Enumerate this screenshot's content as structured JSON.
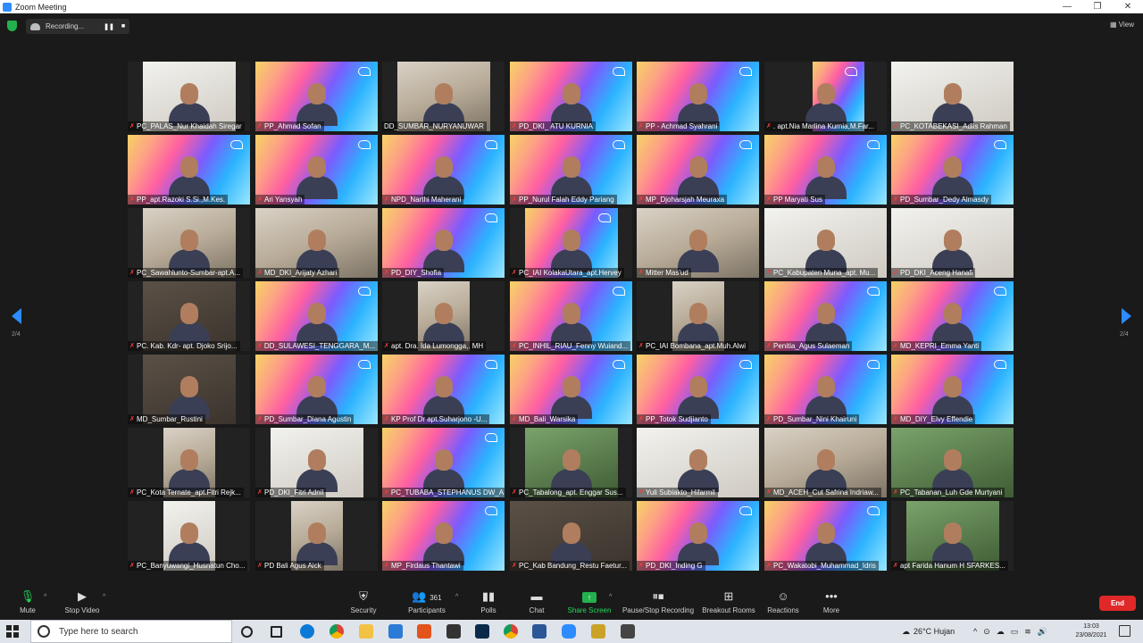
{
  "window": {
    "title": "Zoom Meeting",
    "controls": [
      "—",
      "❐",
      "✕"
    ]
  },
  "meeting_bar": {
    "recording_label": "Recording...",
    "pause_icon": "pause-icon",
    "stop_icon": "stop-icon",
    "view_label": "View"
  },
  "pagination": {
    "left_page": "2/4",
    "right_page": "2/4"
  },
  "participants_grid": [
    [
      {
        "name": "PC_PALAS_Nur Khaidah Siregar",
        "muted": true,
        "bg": "white"
      },
      {
        "name": "PP_Ahmad Sofan",
        "muted": true,
        "bg": "rak"
      },
      {
        "name": "DD_SUMBAR_NURYANUWAR",
        "muted": false,
        "bg": "room"
      },
      {
        "name": "PD_DKI_ ATU KURNIA",
        "muted": true,
        "bg": "rak"
      },
      {
        "name": "PP - Achmad Syahrani",
        "muted": true,
        "bg": "rak"
      },
      {
        "name": ". apt.Nia Marlina Kurnia,M.Far...",
        "muted": true,
        "bg": "rak"
      },
      {
        "name": "PC_KOTABEKASI_Adlis Rahman",
        "muted": true,
        "bg": "white"
      }
    ],
    [
      {
        "name": "PP_apt.Razoki S.Si.,M.Kes.",
        "muted": true,
        "bg": "rak"
      },
      {
        "name": "Ari Yansyah",
        "muted": true,
        "bg": "rak"
      },
      {
        "name": "NPD_Narthi Maherani",
        "muted": true,
        "bg": "rak"
      },
      {
        "name": "PP_Nurul  Falah Eddy Pariang",
        "muted": true,
        "bg": "rak"
      },
      {
        "name": "MP_Djoharsjah Meuraxa",
        "muted": true,
        "bg": "rak"
      },
      {
        "name": "PP Maryati Sus",
        "muted": true,
        "bg": "rak"
      },
      {
        "name": "PD_Sumbar_Dedy Almasdy",
        "muted": true,
        "bg": "rak"
      }
    ],
    [
      {
        "name": "PC_Sawahlunto-Sumbar-apt.A...",
        "muted": true,
        "bg": "room"
      },
      {
        "name": "MD_DKI_Arijaty Azhari",
        "muted": true,
        "bg": "room"
      },
      {
        "name": "PD_DIY_Shofia",
        "muted": true,
        "bg": "rak"
      },
      {
        "name": "PC_IAI KolakaUtara_apt.Hervey",
        "muted": true,
        "bg": "rak"
      },
      {
        "name": "Mitter Mas'ud",
        "muted": true,
        "bg": "room"
      },
      {
        "name": "PC_Kabupaten Muna_apt. Mu...",
        "muted": true,
        "bg": "white"
      },
      {
        "name": "PD_DKI_Aceng Hanafi",
        "muted": true,
        "bg": "white"
      }
    ],
    [
      {
        "name": "PC. Kab. Kdr- apt. Djoko Srijo...",
        "muted": true,
        "bg": "dark"
      },
      {
        "name": "DD_SULAWESI_TENGGARA_M...",
        "muted": true,
        "bg": "rak"
      },
      {
        "name": "apt. Dra. Ida Lumongga,. MH",
        "muted": true,
        "bg": "room"
      },
      {
        "name": "PC_INHIL_RIAU_Fenny Wuiand...",
        "muted": true,
        "bg": "rak"
      },
      {
        "name": "PC_IAI Bombana_apt.Muh.Alwi",
        "muted": true,
        "bg": "room"
      },
      {
        "name": "Penitia_Agus Sulaeman",
        "muted": true,
        "bg": "rak"
      },
      {
        "name": "MD_KEPRI_Emma Yanti",
        "muted": true,
        "bg": "rak"
      }
    ],
    [
      {
        "name": "MD_Sumbar_Rustini",
        "muted": true,
        "bg": "dark"
      },
      {
        "name": "PD_Sumbar_Diana Agustin",
        "muted": true,
        "bg": "rak"
      },
      {
        "name": "KP Prof Dr apt.Suharjono -U...",
        "muted": true,
        "bg": "rak"
      },
      {
        "name": "MD_Bali_Warsika",
        "muted": true,
        "bg": "rak"
      },
      {
        "name": "PP_Totok Sudjianto",
        "muted": true,
        "bg": "rak"
      },
      {
        "name": "PD_Sumbar_Nini Khairuni",
        "muted": true,
        "bg": "rak"
      },
      {
        "name": "MD_DIY_Elvy Effendie",
        "muted": true,
        "bg": "rak"
      }
    ],
    [
      {
        "name": "PC_Kota Ternate_apt.Fitri Rejk...",
        "muted": true,
        "bg": "room"
      },
      {
        "name": "PD_DKI_Fitri Adnil",
        "muted": true,
        "bg": "white"
      },
      {
        "name": "PC_TUBABA_STEPHANUS DW_A...",
        "muted": true,
        "bg": "rak"
      },
      {
        "name": "PC_Tabalong_apt. Enggar Sus...",
        "muted": true,
        "bg": "green"
      },
      {
        "name": "Yuli Subiakto_Hifarmil",
        "muted": true,
        "bg": "white"
      },
      {
        "name": "MD_ACEH_Cut Safrina Indriaw...",
        "muted": true,
        "bg": "room"
      },
      {
        "name": "PC_Tabanan_Luh Gde Murtyani",
        "muted": true,
        "bg": "green"
      }
    ],
    [
      {
        "name": "PC_Banyuwangi_Husnatun Cho...",
        "muted": true,
        "bg": "white"
      },
      {
        "name": "PD Bali Agus Aick",
        "muted": true,
        "bg": "room"
      },
      {
        "name": "MP_Firdaus Thantawi",
        "muted": true,
        "bg": "rak"
      },
      {
        "name": "PC_Kab Bandung_Restu Faetur...",
        "muted": true,
        "bg": "dark"
      },
      {
        "name": "PD_DKI_Inding G",
        "muted": true,
        "bg": "rak"
      },
      {
        "name": "PC_Wakatobi_Muhammad_Idris",
        "muted": true,
        "bg": "rak"
      },
      {
        "name": "apt Farida Hanum  H SFARKES...",
        "muted": true,
        "bg": "green"
      }
    ]
  ],
  "toolbar": {
    "mute": "Mute",
    "stop_video": "Stop Video",
    "security": "Security",
    "participants": "Participants",
    "participant_count": "361",
    "polls": "Polls",
    "chat": "Chat",
    "share_screen": "Share Screen",
    "recording": "Pause/Stop Recording",
    "breakout": "Breakout Rooms",
    "reactions": "Reactions",
    "more": "More",
    "end": "End"
  },
  "taskbar": {
    "search_placeholder": "Type here to search",
    "weather": "26°C  Hujan",
    "time": "13:03",
    "date": "23/08/2021"
  },
  "colors": {
    "accent": "#2d8cff",
    "share_green": "#23b14d",
    "end_red": "#e02828"
  }
}
